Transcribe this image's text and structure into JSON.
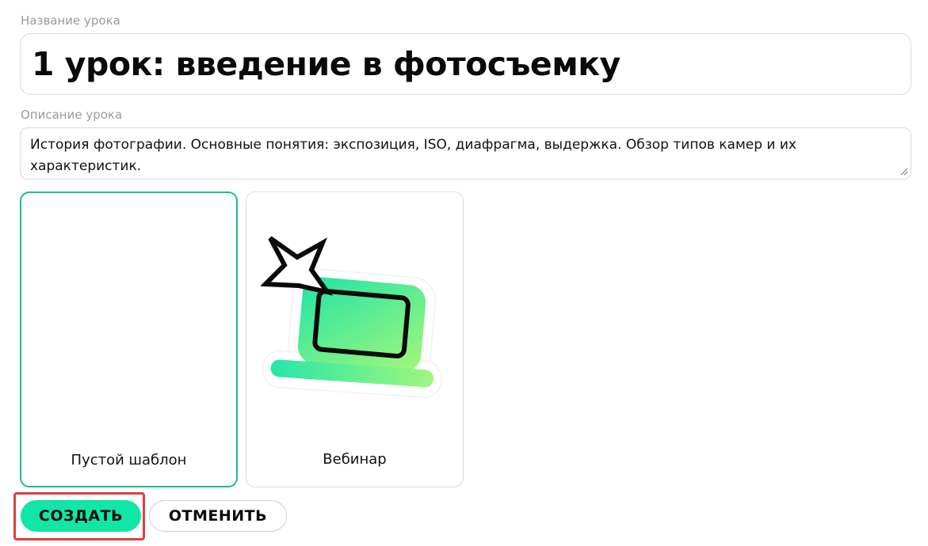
{
  "lesson_form": {
    "title_label": "Название урока",
    "title_value": "1 урок: введение в фотосъемку",
    "description_label": "Описание урока",
    "description_value": "История фотографии. Основные понятия: экспозиция, ISO, диафрагма, выдержка. Обзор типов камер и их характеристик."
  },
  "templates": [
    {
      "label": "Пустой шаблон",
      "selected": true
    },
    {
      "label": "Вебинар",
      "selected": false,
      "icon": "laptop-with-star-icon"
    }
  ],
  "actions": {
    "create_label": "СОЗДАТЬ",
    "cancel_label": "ОТМЕНИТЬ"
  },
  "colors": {
    "accent": "#12e6a6",
    "selected_border": "#1bbf8a",
    "highlight": "#d9413f"
  }
}
